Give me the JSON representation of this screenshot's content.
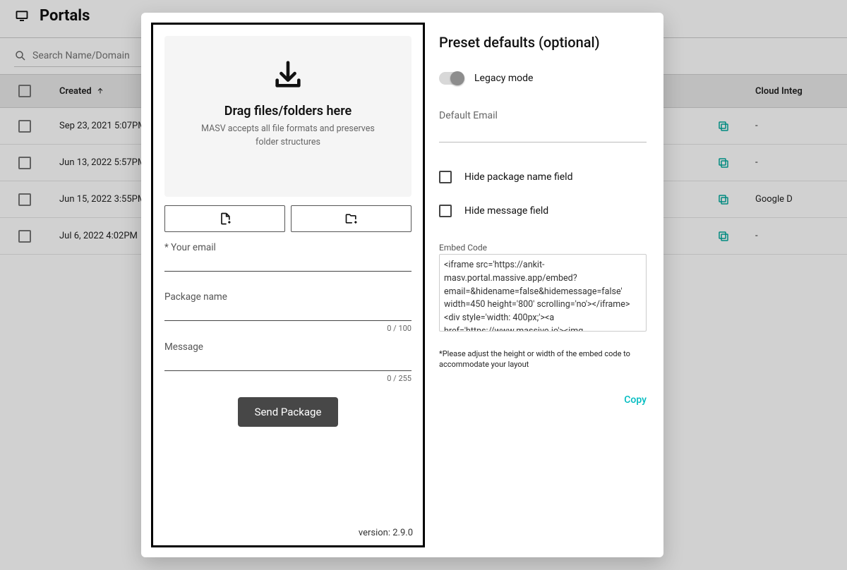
{
  "header": {
    "title": "Portals"
  },
  "search": {
    "placeholder": "Search Name/Domain"
  },
  "columns": {
    "created": "Created",
    "cloud": "Cloud Integ"
  },
  "rows": [
    {
      "created": "Sep 23, 2021 5:07PM",
      "cloud": "-"
    },
    {
      "created": "Jun 13, 2022 5:57PM",
      "cloud": "-"
    },
    {
      "created": "Jun 15, 2022 3:55PM",
      "cloud": "Google D"
    },
    {
      "created": "Jul 6, 2022 4:02PM",
      "cloud": "-"
    }
  ],
  "modal": {
    "left": {
      "drop_title": "Drag files/folders here",
      "drop_sub": "MASV accepts all file formats and preserves folder structures",
      "email_label": "* Your email",
      "package_label": "Package name",
      "package_counter": "0 / 100",
      "message_label": "Message",
      "message_counter": "0 / 255",
      "send_label": "Send Package",
      "version": "version: 2.9.0"
    },
    "right": {
      "title": "Preset defaults (optional)",
      "legacy_label": "Legacy mode",
      "default_email_label": "Default Email",
      "hide_pkg_label": "Hide package name field",
      "hide_msg_label": "Hide message field",
      "embed_label": "Embed Code",
      "embed_value": "<iframe src='https://ankit-masv.portal.massive.app/embed?email=&hidename=false&hidemessage=false' width=450 height='800' scrolling='no'></iframe><div style='width: 400px;'><a href='https://www.massive.io'><img ",
      "hint": "*Please adjust the height or width of the embed code to accommodate your layout",
      "copy_label": "Copy"
    }
  }
}
